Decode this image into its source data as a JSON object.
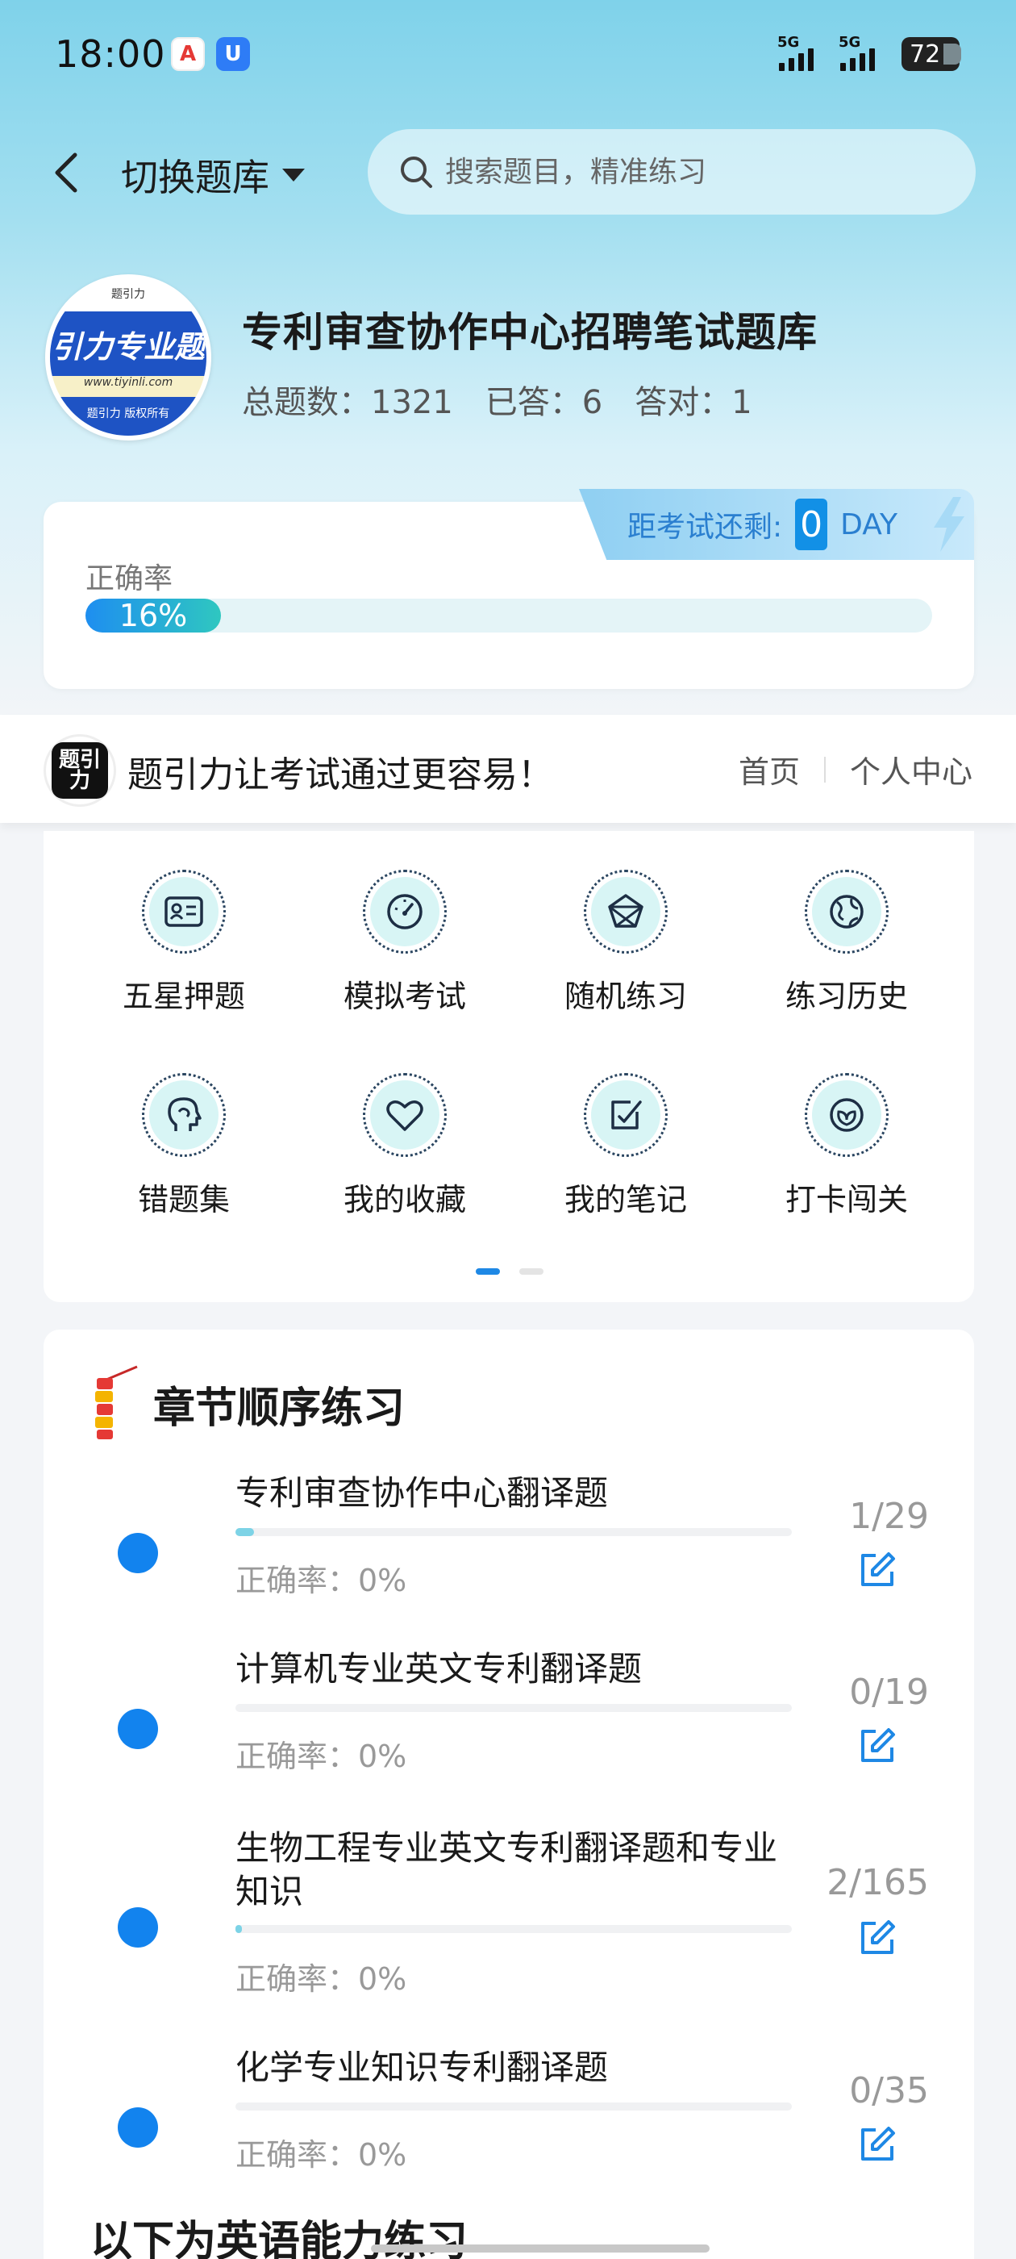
{
  "status_bar": {
    "time": "18:00",
    "network1": "5G",
    "network2": "5G",
    "battery": "72"
  },
  "top_nav": {
    "switch_label": "切换题库",
    "search_placeholder": "搜索题目，精准练习"
  },
  "bank": {
    "logo_text": "引力专业题",
    "logo_top": "题引力",
    "logo_url": "www.tiyinli.com",
    "logo_bottom": "题引力 版权所有",
    "title": "专利审查协作中心招聘笔试题库",
    "total_label": "总题数：1321",
    "answered_label": "已答：6",
    "correct_label": "答对：1"
  },
  "accuracy": {
    "exam_prefix": "距考试还剩:",
    "days": "0",
    "day_unit": "DAY",
    "label": "正确率",
    "percent_text": "16%",
    "percent": 0.16
  },
  "slogan": {
    "logo_text": "题引力",
    "text": "题引力让考试通过更容易！",
    "home": "首页",
    "personal": "个人中心"
  },
  "functions": [
    {
      "label": "五星押题",
      "icon": "id-card-icon"
    },
    {
      "label": "模拟考试",
      "icon": "gauge-icon"
    },
    {
      "label": "随机练习",
      "icon": "shuffle-icon"
    },
    {
      "label": "练习历史",
      "icon": "globe-icon"
    },
    {
      "label": "错题集",
      "icon": "head-icon"
    },
    {
      "label": "我的收藏",
      "icon": "heart-icon"
    },
    {
      "label": "我的笔记",
      "icon": "note-check-icon"
    },
    {
      "label": "打卡闯关",
      "icon": "leaf-check-icon"
    }
  ],
  "chapters": {
    "title": "章节顺序练习",
    "items": [
      {
        "name": "专利审查协作中心翻译题",
        "count": "1/29",
        "accuracy": "正确率：0%",
        "progress": 0.034
      },
      {
        "name": "计算机专业英文专利翻译题",
        "count": "0/19",
        "accuracy": "正确率：0%",
        "progress": 0
      },
      {
        "name": "生物工程专业英文专利翻译题和专业知识",
        "count": "2/165",
        "accuracy": "正确率：0%",
        "progress": 0.012
      },
      {
        "name": "化学专业知识专利翻译题",
        "count": "0/35",
        "accuracy": "正确率：0%",
        "progress": 0
      }
    ]
  },
  "english_section_title": "以下为英语能力练习"
}
